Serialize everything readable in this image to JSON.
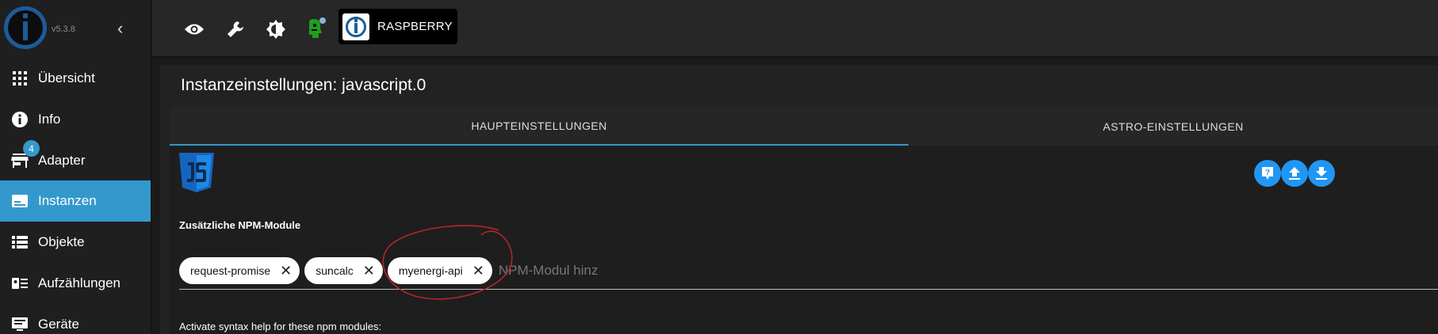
{
  "app": {
    "version": "v5.3.8"
  },
  "sidebar": {
    "items": [
      {
        "label": "Übersicht",
        "icon": "grid-icon"
      },
      {
        "label": "Info",
        "icon": "info-icon"
      },
      {
        "label": "Adapter",
        "icon": "store-icon",
        "badge": "4"
      },
      {
        "label": "Instanzen",
        "icon": "instances-icon",
        "active": true
      },
      {
        "label": "Objekte",
        "icon": "list-icon"
      },
      {
        "label": "Aufzählungen",
        "icon": "enum-icon"
      },
      {
        "label": "Geräte",
        "icon": "devices-icon"
      }
    ]
  },
  "topbar": {
    "host_name": "RASPBERRY",
    "icons": [
      "eye-icon",
      "wrench-icon",
      "brightness-icon",
      "expert-mode-icon"
    ]
  },
  "dialog": {
    "title": "Instanzeinstellungen: javascript.0",
    "tabs": [
      {
        "label": "HAUPTEINSTELLUNGEN",
        "active": true
      },
      {
        "label": "ASTRO-EINSTELLUNGEN",
        "active": false
      }
    ],
    "npm_modules_label": "Zusätzliche NPM-Module",
    "npm_modules": [
      "request-promise",
      "suncalc",
      "myenergi-api"
    ],
    "npm_input_placeholder": "NPM-Modul hinz",
    "syntax_help_label": "Activate syntax help for these npm modules:"
  },
  "colors": {
    "accent": "#3399cc",
    "button_blue": "#2196f3",
    "annotation_red": "#b3262b"
  }
}
